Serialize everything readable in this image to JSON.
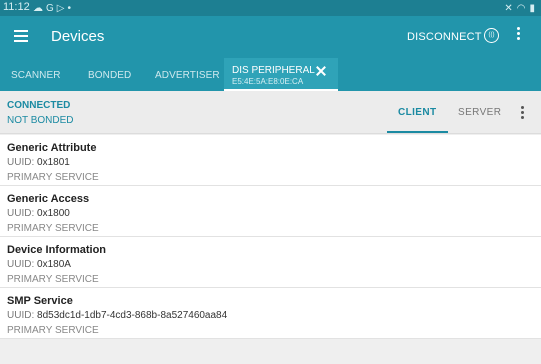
{
  "status_bar": {
    "time": "11:12",
    "left_icons": [
      "☁",
      "G",
      "▷",
      "•"
    ],
    "right_icons": [
      "✕",
      "◠",
      "▮"
    ]
  },
  "app_bar": {
    "title": "Devices",
    "disconnect_label": "DISCONNECT",
    "rssi_label": "(()"
  },
  "tabs": {
    "scanner": "SCANNER",
    "bonded": "BONDED",
    "advertiser": "ADVERTISER",
    "active": {
      "label": "DIS PERIPHERAL",
      "address": "E5:4E:5A:E8:0E:CA"
    }
  },
  "connection": {
    "status": "CONNECTED",
    "bond": "NOT BONDED",
    "mode_client": "CLIENT",
    "mode_server": "SERVER"
  },
  "services": [
    {
      "name": "Generic Attribute",
      "uuid_label": "UUID:",
      "uuid": "0x1801",
      "type": "PRIMARY SERVICE"
    },
    {
      "name": "Generic Access",
      "uuid_label": "UUID:",
      "uuid": "0x1800",
      "type": "PRIMARY SERVICE"
    },
    {
      "name": "Device Information",
      "uuid_label": "UUID:",
      "uuid": "0x180A",
      "type": "PRIMARY SERVICE"
    },
    {
      "name": "SMP Service",
      "uuid_label": "UUID:",
      "uuid": "8d53dc1d-1db7-4cd3-868b-8a527460aa84",
      "type": "PRIMARY SERVICE"
    }
  ],
  "colors": {
    "primary": "#2295ab",
    "status_bar": "#1d7f92",
    "accent": "#1b8aa2"
  }
}
